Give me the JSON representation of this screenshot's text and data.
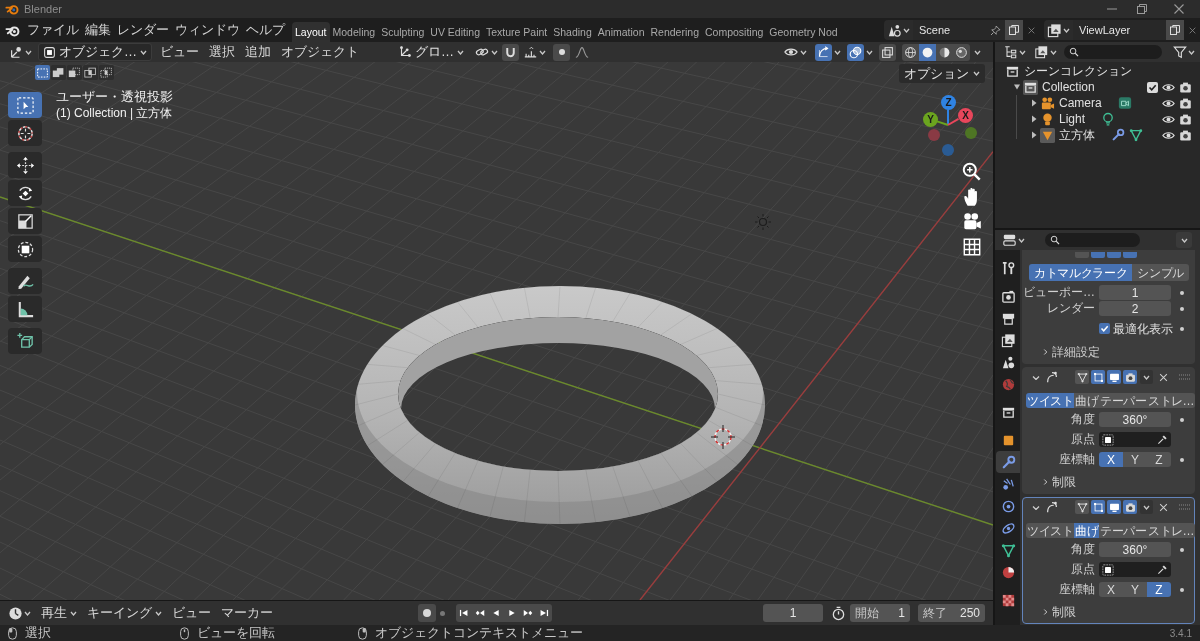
{
  "window": {
    "title": "Blender"
  },
  "menu_bar": [
    "ファイル",
    "編集",
    "レンダー",
    "ウィンドウ",
    "ヘルプ"
  ],
  "workspaces": [
    {
      "label": "Layout",
      "selected": true
    },
    {
      "label": "Modeling",
      "selected": false
    },
    {
      "label": "Sculpting",
      "selected": false
    },
    {
      "label": "UV Editing",
      "selected": false
    },
    {
      "label": "Texture Paint",
      "selected": false
    },
    {
      "label": "Shading",
      "selected": false
    },
    {
      "label": "Animation",
      "selected": false
    },
    {
      "label": "Rendering",
      "selected": false
    },
    {
      "label": "Compositing",
      "selected": false
    },
    {
      "label": "Geometry Nod",
      "selected": false
    }
  ],
  "scene": {
    "value": "Scene"
  },
  "view_layer": {
    "value": "ViewLayer"
  },
  "viewport": {
    "mode": "オブジェク…",
    "menus": [
      "ビュー",
      "選択",
      "追加",
      "オブジェクト"
    ],
    "orientation": "グロ…",
    "toggles": [
      {
        "kind": "gizmos",
        "on": true
      },
      {
        "kind": "overlays",
        "on": true
      },
      {
        "kind": "xray",
        "on": false
      }
    ],
    "shading": [
      {
        "kind": "wireframe",
        "selected": false
      },
      {
        "kind": "solid",
        "selected": true
      },
      {
        "kind": "material",
        "selected": false
      },
      {
        "kind": "rendered",
        "selected": false
      }
    ],
    "select_modes": [
      {
        "kind": "new",
        "selected": true
      },
      {
        "kind": "extend",
        "selected": false
      },
      {
        "kind": "subtract",
        "selected": false
      },
      {
        "kind": "invert",
        "selected": false
      },
      {
        "kind": "intersect",
        "selected": false
      }
    ],
    "options": "オプション",
    "view_info": [
      "ユーザー・透視投影",
      "(1) Collection | 立方体"
    ],
    "tool_groups": [
      {
        "tools": [
          {
            "kind": "select",
            "selected": true
          },
          {
            "kind": "cursor",
            "selected": false
          }
        ]
      },
      {
        "tools": [
          {
            "kind": "move",
            "selected": false
          },
          {
            "kind": "rotate",
            "selected": false
          },
          {
            "kind": "scale",
            "selected": false
          },
          {
            "kind": "transform",
            "selected": false
          }
        ]
      },
      {
        "tools": [
          {
            "kind": "annotate",
            "selected": false
          },
          {
            "kind": "measure",
            "selected": false
          }
        ]
      },
      {
        "tools": [
          {
            "kind": "add_cube",
            "selected": false
          }
        ]
      }
    ],
    "gizmo_axes": [
      {
        "label": "Z",
        "kind": "z"
      },
      {
        "label": "Y",
        "kind": "y"
      },
      {
        "label": "X",
        "kind": "x"
      }
    ]
  },
  "outliner": {
    "items": [
      {
        "label": "シーンコレクション",
        "kind": "scene_collection",
        "children": [
          {
            "label": "Collection",
            "kind": "collection",
            "expanded": true,
            "checked": true,
            "children": [
              {
                "label": "Camera",
                "kind": "camera",
                "expanded": false
              },
              {
                "label": "Light",
                "kind": "light",
                "expanded": false
              },
              {
                "label": "立方体",
                "kind": "mesh",
                "expanded": false
              }
            ]
          }
        ]
      }
    ]
  },
  "properties": {
    "tab_groups": [
      {
        "tabs": [
          {
            "kind": "tool",
            "selected": false
          }
        ]
      },
      {
        "tabs": [
          {
            "kind": "render",
            "selected": false
          },
          {
            "kind": "output",
            "selected": false
          },
          {
            "kind": "view_layer",
            "selected": false
          },
          {
            "kind": "scene",
            "selected": false
          },
          {
            "kind": "world",
            "selected": false
          }
        ]
      },
      {
        "tabs": [
          {
            "kind": "collection",
            "selected": false
          }
        ]
      },
      {
        "tabs": [
          {
            "kind": "object",
            "selected": false
          },
          {
            "kind": "modifier",
            "selected": true
          },
          {
            "kind": "particles",
            "selected": false
          },
          {
            "kind": "physics",
            "selected": false
          },
          {
            "kind": "constraints",
            "selected": false
          },
          {
            "kind": "data",
            "selected": false
          },
          {
            "kind": "material",
            "selected": false
          }
        ]
      },
      {
        "tabs": [
          {
            "kind": "texture",
            "selected": false
          }
        ]
      }
    ],
    "top_panel": {
      "header_toggles": [
        {
          "on": false
        },
        {
          "on": true
        },
        {
          "on": true
        },
        {
          "on": true
        }
      ],
      "types": [
        {
          "label": "カトマルクラーク",
          "selected": true
        },
        {
          "label": "シンプル",
          "selected": false
        }
      ],
      "levels": [
        {
          "label": "ビューポー…",
          "value": "1"
        },
        {
          "label": "レンダー",
          "value": "2"
        }
      ],
      "optimal_display": {
        "label": "最適化表示",
        "checked": true
      },
      "advanced": "詳細設定"
    },
    "modifier_panels": [
      {
        "active": false,
        "toggles": [
          {
            "kind": "on_cage",
            "on": false
          },
          {
            "kind": "edit_mode",
            "on": true
          },
          {
            "kind": "viewport",
            "on": true
          },
          {
            "kind": "render",
            "on": true
          }
        ],
        "methods": [
          {
            "label": "ツイスト",
            "selected": true
          },
          {
            "label": "曲げ",
            "selected": false
          },
          {
            "label": "テーパー",
            "selected": false
          },
          {
            "label": "ストレ…",
            "selected": false
          }
        ],
        "angle": {
          "label": "角度",
          "value": "360°"
        },
        "origin": {
          "label": "原点"
        },
        "axis": {
          "label": "座標軸",
          "options": [
            {
              "label": "X",
              "selected": true
            },
            {
              "label": "Y",
              "selected": false
            },
            {
              "label": "Z",
              "selected": false
            }
          ]
        },
        "limits": "制限"
      },
      {
        "active": true,
        "toggles": [
          {
            "kind": "on_cage",
            "on": false
          },
          {
            "kind": "edit_mode",
            "on": true
          },
          {
            "kind": "viewport",
            "on": true
          },
          {
            "kind": "render",
            "on": true
          }
        ],
        "methods": [
          {
            "label": "ツイスト",
            "selected": false
          },
          {
            "label": "曲げ",
            "selected": true
          },
          {
            "label": "テーパー",
            "selected": false
          },
          {
            "label": "ストレ…",
            "selected": false
          }
        ],
        "angle": {
          "label": "角度",
          "value": "360°"
        },
        "origin": {
          "label": "原点"
        },
        "axis": {
          "label": "座標軸",
          "options": [
            {
              "label": "X",
              "selected": false
            },
            {
              "label": "Y",
              "selected": false
            },
            {
              "label": "Z",
              "selected": true
            }
          ]
        },
        "limits": "制限"
      }
    ]
  },
  "timeline": {
    "menus": [
      {
        "label": "再生",
        "kind": "dropdown"
      },
      {
        "label": "キーイング",
        "kind": "dropdown"
      },
      {
        "label": "ビュー",
        "kind": "menu"
      },
      {
        "label": "マーカー",
        "kind": "menu"
      }
    ],
    "current_frame": "1",
    "start": {
      "label": "開始",
      "value": "1"
    },
    "end": {
      "label": "終了",
      "value": "250"
    }
  },
  "status_bar": {
    "hints": [
      {
        "label": "選択",
        "kind": "left"
      },
      {
        "label": "ビューを回転",
        "kind": "middle"
      },
      {
        "label": "オブジェクトコンテキストメニュー",
        "kind": "right"
      }
    ],
    "version": "3.4.1"
  }
}
